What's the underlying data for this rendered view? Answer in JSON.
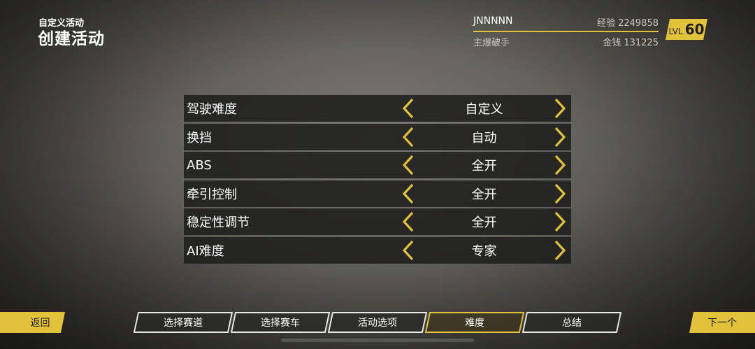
{
  "header": {
    "subtitle": "自定义活动",
    "title": "创建活动"
  },
  "player": {
    "name": "JNNNNN",
    "title": "主爆破手",
    "xp_label": "经验",
    "xp_value": "2249858",
    "money_label": "金钱",
    "money_value": "131225",
    "level_label": "LVL",
    "level_value": "60"
  },
  "settings": [
    {
      "label": "驾驶难度",
      "value": "自定义"
    },
    {
      "label": "换挡",
      "value": "自动"
    },
    {
      "label": "ABS",
      "value": "全开"
    },
    {
      "label": "牵引控制",
      "value": "全开"
    },
    {
      "label": "稳定性调节",
      "value": "全开"
    },
    {
      "label": "AI难度",
      "value": "专家"
    }
  ],
  "nav": {
    "back": "返回",
    "next": "下一个",
    "tabs": [
      "选择赛道",
      "选择赛车",
      "活动选项",
      "难度",
      "总结"
    ],
    "active_tab": "难度"
  },
  "colors": {
    "accent": "#e2c23b",
    "panel": "#1e1e1c"
  },
  "icons": {
    "prev": "chevron-left-icon",
    "next": "chevron-right-icon"
  }
}
